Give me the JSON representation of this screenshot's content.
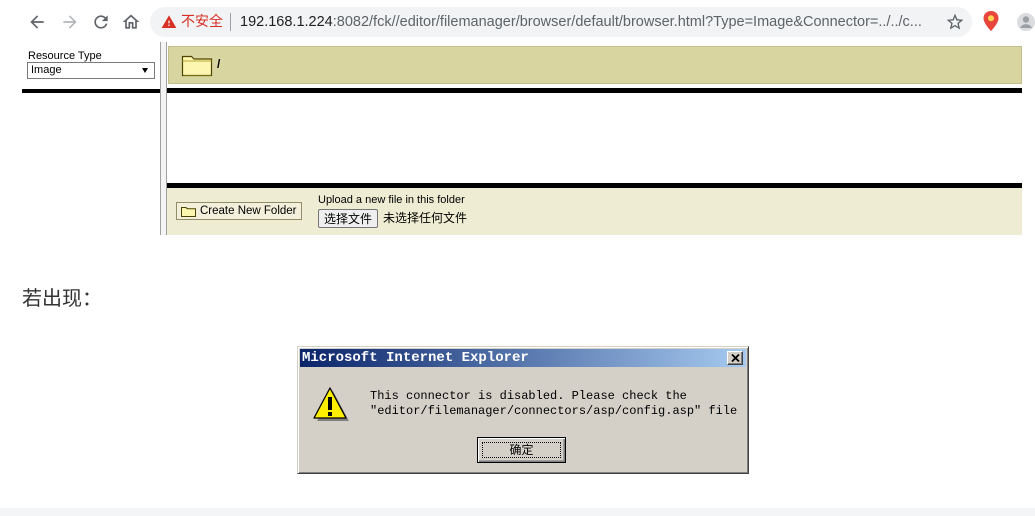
{
  "browser": {
    "security_label": "不安全",
    "url_host": "192.168.1.224",
    "url_path": ":8082/fck//editor/filemanager/browser/default/browser.html?Type=Image&Connector=../../c..."
  },
  "file_browser": {
    "resource_type_label": "Resource Type",
    "resource_type_value": "Image",
    "current_folder": "/",
    "create_folder_label": "Create New Folder",
    "upload_label": "Upload a new file in this folder",
    "choose_file_label": "选择文件",
    "no_file_selected": "未选择任何文件"
  },
  "article": {
    "paragraph": "若出现："
  },
  "dialog": {
    "title": "Microsoft Internet Explorer",
    "message_lines": [
      "This connector is disabled. Please check the",
      "\"editor/filemanager/connectors/asp/config.asp\" file"
    ],
    "ok_label": "确定"
  },
  "icons": {
    "back": "arrow-left-icon",
    "forward": "arrow-right-icon",
    "reload": "reload-icon",
    "home": "home-icon",
    "security": "warning-triangle-icon",
    "bookmark": "star-icon",
    "extension": "map-pin-icon",
    "profile": "avatar-icon",
    "folder": "folder-icon",
    "dropdown": "chevron-down-icon",
    "dialog_warning": "warning-icon",
    "dialog_close": "close-icon"
  },
  "colors": {
    "security-warning": "#d93025",
    "folder-bar-bg": "#d8d5a1",
    "footer-bg": "#eeecd2",
    "dialog-title-start": "#0a246a",
    "dialog-title-end": "#a6caf0",
    "dialog-face": "#d4d0c8"
  }
}
